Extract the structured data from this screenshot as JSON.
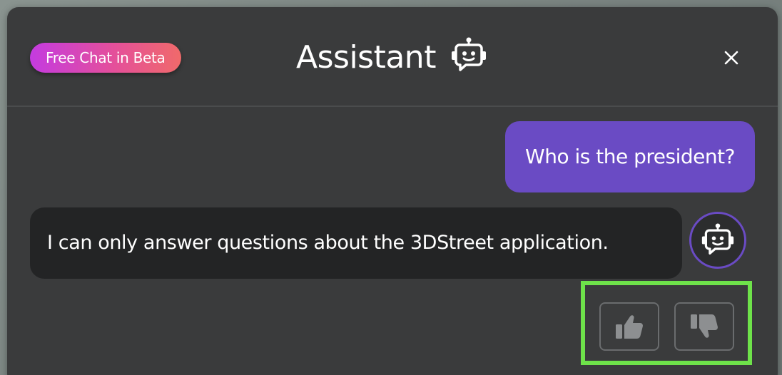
{
  "header": {
    "badge": "Free Chat in Beta",
    "title": "Assistant",
    "title_icon": "robot-chat-icon",
    "close_icon": "close-icon"
  },
  "messages": [
    {
      "role": "user",
      "text": "Who is the president?"
    },
    {
      "role": "assistant",
      "text": "I can only answer questions about the 3DStreet application."
    }
  ],
  "feedback": {
    "thumbs_up_icon": "thumbs-up-icon",
    "thumbs_down_icon": "thumbs-down-icon",
    "highlight_color": "#6ee24a"
  },
  "colors": {
    "panel": "#3a3b3c",
    "user_bubble": "#6a4bc4",
    "assistant_bubble": "#232425",
    "badge_gradient_start": "#c43be0",
    "badge_gradient_end": "#f06a6a"
  }
}
